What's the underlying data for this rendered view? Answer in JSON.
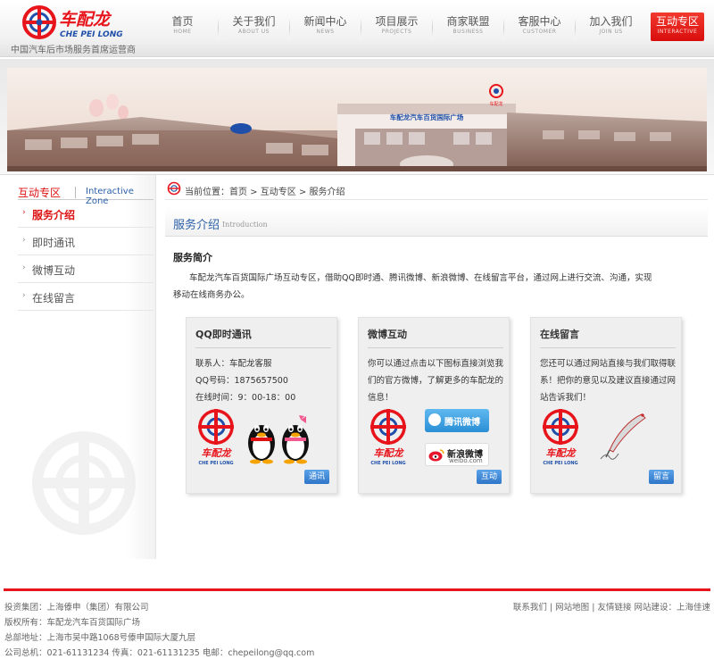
{
  "brand": {
    "name_cn": "车配龙",
    "name_en": "CHE PEI LONG",
    "tagline": "中国汽车后市场服务首席运营商"
  },
  "nav": [
    {
      "cn": "首页",
      "en": "HOME"
    },
    {
      "cn": "关于我们",
      "en": "ABOUT US"
    },
    {
      "cn": "新闻中心",
      "en": "NEWS"
    },
    {
      "cn": "项目展示",
      "en": "PROJECTS"
    },
    {
      "cn": "商家联盟",
      "en": "BUSINESS"
    },
    {
      "cn": "客服中心",
      "en": "CUSTOMER"
    },
    {
      "cn": "加入我们",
      "en": "JOIN US"
    },
    {
      "cn": "互动专区",
      "en": "INTERACTIVE"
    }
  ],
  "banner": {
    "sign": "车配龙汽车百货国际广场",
    "roof_sign": "车配龙"
  },
  "sidebar": {
    "title_cn": "互动专区",
    "title_en": "Interactive Zone",
    "items": [
      {
        "label": "服务介绍"
      },
      {
        "label": "即时通讯"
      },
      {
        "label": "微博互动"
      },
      {
        "label": "在线留言"
      }
    ]
  },
  "breadcrumb": {
    "prefix": "当前位置：",
    "home": "首页",
    "sep": " > ",
    "section": "互动专区",
    "page": "服务介绍"
  },
  "page_title": {
    "cn": "服务介绍",
    "en": "Introduction"
  },
  "intro": {
    "heading": "服务简介",
    "text": "车配龙汽车百货国际广场互动专区，借助QQ即时通、腾讯微博、新浪微博、在线留言平台，通过网上进行交流、沟通，实现移动在线商务办公。"
  },
  "cards": {
    "qq": {
      "title": "QQ即时通讯",
      "line1": "联系人：车配龙客服",
      "line2": "QQ号码：1875657500",
      "line3": "在线时间：9：00-18：00",
      "button": "通讯"
    },
    "weibo": {
      "title": "微博互动",
      "text": "你可以通过点击以下图标直接浏览我们的官方微博，了解更多的车配龙的信息！",
      "tencent": "腾讯微博",
      "sina": "新浪微博",
      "sina_en": "weibo.com",
      "button": "互动"
    },
    "message": {
      "title": "在线留言",
      "text": "您还可以通过网站直接与我们取得联系！把你的意见以及建议直接通过网站告诉我们！",
      "button": "留言"
    }
  },
  "footer": {
    "line1": "投资集团：上海傣申（集团）有限公司",
    "line2": "版权所有：车配龙汽车百货国际广场",
    "line3": "总部地址：上海市吴中路1068号傣申国际大厦九层",
    "line4": "公司总机：021-61131234  传真：021-61131235  电邮：chepeilong@qq.com",
    "links": [
      "联系我们",
      "网站地图",
      "友情链接"
    ],
    "sep": "|",
    "build": "网站建设：上海佳速"
  },
  "colors": {
    "brand_red": "#e8141b",
    "link_blue": "#2a5fa8",
    "button_blue": "#2f76c8"
  }
}
